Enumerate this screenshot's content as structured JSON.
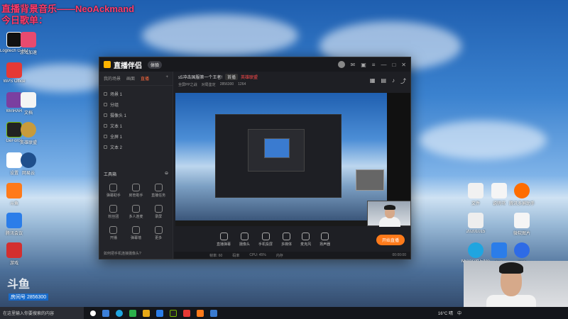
{
  "overlay": {
    "line1": "直播背景音乐——NeoAckmand",
    "line2": "今日歌单："
  },
  "desktop_icons_left": [
    {
      "label": "Logitech G HUB"
    },
    {
      "label": "游戏加速"
    },
    {
      "label": "WPS Office"
    },
    {
      "label": ""
    },
    {
      "label": "WinRAR"
    },
    {
      "label": "文档"
    },
    {
      "label": "GeForce"
    },
    {
      "label": "英雄联盟"
    },
    {
      "label": "设置"
    },
    {
      "label": "网易云"
    },
    {
      "label": "斗鱼"
    },
    {
      "label": "腾讯会议"
    },
    {
      "label": "游戏"
    }
  ],
  "desktop_icons_right": [
    {
      "label": "腾讯多屏助手"
    },
    {
      "label": "文件"
    },
    {
      "label": "说明书"
    },
    {
      "label": "微软图片"
    },
    {
      "label": "20201015"
    },
    {
      "label": "Microsoft Edge"
    },
    {
      "label": "安全"
    },
    {
      "label": "百度"
    }
  ],
  "app": {
    "name": "直播伴侣",
    "version": "体验",
    "left_tabs": [
      "我的场景",
      "画面",
      "直播"
    ],
    "scenes": [
      "场景 1",
      "分组",
      "摄像头 1",
      "文本 1",
      "全屏 1",
      "文本 2"
    ],
    "tools_title": "工具箱",
    "tools": [
      "弹幕助手",
      "房管助手",
      "直播任务",
      "粉丝团",
      "多人连麦",
      "录屏",
      "开播",
      "弹幕墙",
      "更多"
    ],
    "footer_tip": "如何把手机连接摄像头?",
    "room_title": "s5冲击国服第一个王者!",
    "room_tag": "英雄联盟",
    "room_tag2": "首播",
    "room_meta1": "全屏PP之战",
    "room_meta2": "对局鉴定",
    "room_id": "2856300",
    "room_hot": "1264",
    "controls": [
      "直播弹幕",
      "摄像头",
      "手机投屏",
      "多媒体",
      "麦克风",
      "扬声器"
    ],
    "go_live": "开始直播",
    "status": [
      "帧率: 60",
      "码率",
      "CPU: 45%",
      "内存",
      "00:00:00"
    ]
  },
  "watermark": {
    "brand": "斗鱼",
    "sub": "房间号 2856300"
  },
  "taskbar": {
    "search_placeholder": "在这里输入你要搜索的内容",
    "weather": "16°C 晴",
    "lang": "中"
  },
  "colors": {
    "accent": "#ff7a1a",
    "overlay_text": "#ff3b6b"
  }
}
